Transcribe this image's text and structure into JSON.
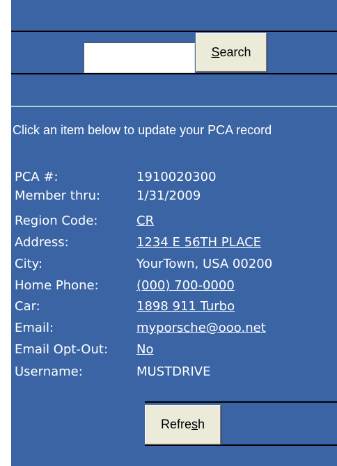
{
  "search": {
    "input_value": "",
    "button_prefix": "",
    "button_accel": "S",
    "button_suffix": "earch"
  },
  "instructions": "Click an item below to update your PCA record",
  "record": {
    "pca_label": "PCA #:",
    "pca_value": "1910020300",
    "member_label": "Member thru:",
    "member_value": "1/31/2009",
    "region_label": "Region Code:",
    "region_value": "CR",
    "address_label": "Address:",
    "address_value": "1234 E 56TH PLACE",
    "city_label": "City:",
    "city_value": "YourTown, USA  00200",
    "phone_label": "Home Phone:",
    "phone_value": "(000) 700-0000",
    "car_label": "Car:",
    "car_value": "1898 911 Turbo",
    "email_label": "Email:",
    "email_value": "myporsche@ooo.net",
    "optout_label": "Email Opt-Out:",
    "optout_value": "No",
    "username_label": "Username:",
    "username_value": "MUSTDRIVE"
  },
  "refresh": {
    "button_prefix": "Refre",
    "button_accel": "s",
    "button_suffix": "h"
  },
  "colors": {
    "panel": "#3a64a4",
    "button": "#ecead8",
    "divider": "#a9d7c4"
  }
}
